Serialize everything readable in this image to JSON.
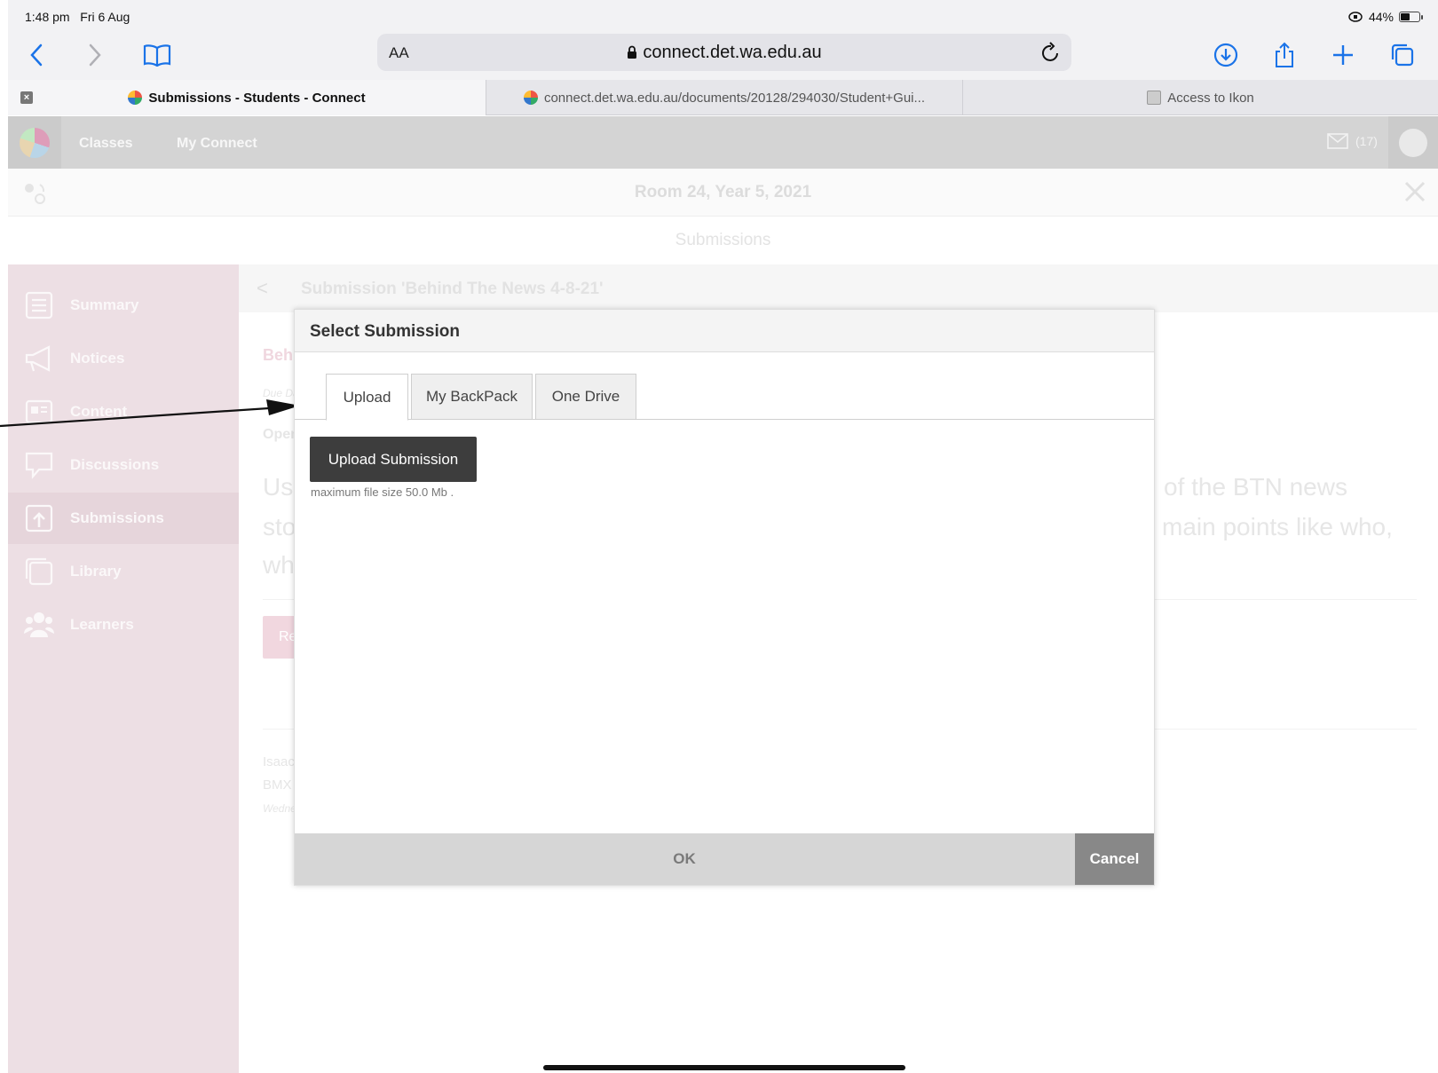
{
  "status_bar": {
    "time": "1:48 pm",
    "date": "Fri 6 Aug",
    "battery_percent": "44%",
    "battery_level": 0.44
  },
  "toolbar": {
    "text_size_label": "AA",
    "url": "connect.det.wa.edu.au"
  },
  "browser_tabs": [
    {
      "title": "Submissions - Students - Connect"
    },
    {
      "title": "connect.det.wa.edu.au/documents/20128/294030/Student+Gui..."
    },
    {
      "title": "Access to Ikon"
    }
  ],
  "site_nav": {
    "classes": "Classes",
    "my_connect": "My Connect",
    "mail_count": "(17)"
  },
  "room_title": "Room 24, Year 5, 2021",
  "page_title": "Submissions",
  "sidebar": {
    "items": [
      {
        "label": "Summary",
        "icon": "summary-icon"
      },
      {
        "label": "Notices",
        "icon": "megaphone-icon"
      },
      {
        "label": "Content",
        "icon": "content-icon"
      },
      {
        "label": "Discussions",
        "icon": "speech-bubble-icon"
      },
      {
        "label": "Submissions",
        "icon": "upload-icon"
      },
      {
        "label": "Library",
        "icon": "library-icon"
      },
      {
        "label": "Learners",
        "icon": "people-icon"
      }
    ]
  },
  "background": {
    "submission_title": "Submission 'Behind The News 4-8-21'",
    "heading_fragment": "Behi",
    "due_fragment": "Due Da",
    "open_fragment": "Open",
    "body_left_1": "Use",
    "body_left_2": "stor",
    "body_left_3": "wha",
    "body_right_1": "of the BTN news",
    "body_right_2": "main points like who,",
    "button_fragment": "Re-",
    "author_fragment": "Isaac",
    "topic_fragment": "BMX A",
    "date_fragment": "Wedne"
  },
  "dialog": {
    "title": "Select Submission",
    "tabs": [
      "Upload",
      "My BackPack",
      "One Drive"
    ],
    "upload_button": "Upload Submission",
    "file_note": "maximum file size 50.0 Mb .",
    "ok_label": "OK",
    "cancel_label": "Cancel"
  }
}
